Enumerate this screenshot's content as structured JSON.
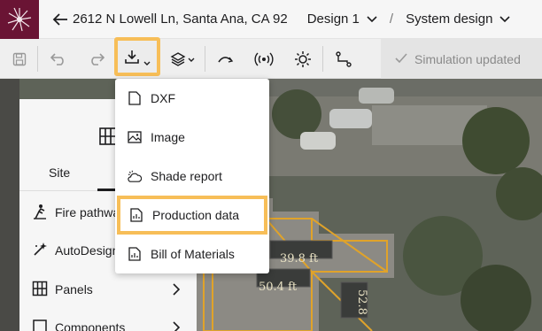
{
  "header": {
    "address": "2612 N Lowell Ln, Santa Ana, CA 92",
    "design_label": "Design 1",
    "separator": "/",
    "mode_label": "System design"
  },
  "toolbar": {
    "simulation_status": "Simulation updated"
  },
  "download_menu": {
    "items": [
      {
        "label": "DXF",
        "icon": "file-icon"
      },
      {
        "label": "Image",
        "icon": "image-icon"
      },
      {
        "label": "Shade report",
        "icon": "shade-icon"
      },
      {
        "label": "Production data",
        "icon": "spreadsheet-icon",
        "highlighted": true
      },
      {
        "label": "Bill of Materials",
        "icon": "spreadsheet-icon"
      }
    ]
  },
  "panel": {
    "tab_site": "Site",
    "items": [
      {
        "label": "Fire pathwa",
        "icon": "fire-pathway-icon"
      },
      {
        "label": "AutoDesign",
        "icon": "sparkle-icon"
      },
      {
        "label": "Panels",
        "icon": "grid-icon"
      },
      {
        "label": "Components",
        "icon": "component-icon"
      }
    ]
  },
  "map": {
    "dimension_labels": [
      "39.8 ft",
      "50.4 ft",
      "52.8"
    ]
  },
  "colors": {
    "brand": "#6a1434",
    "highlight": "#f7be58",
    "fire_pathway": "#e0a32a"
  }
}
